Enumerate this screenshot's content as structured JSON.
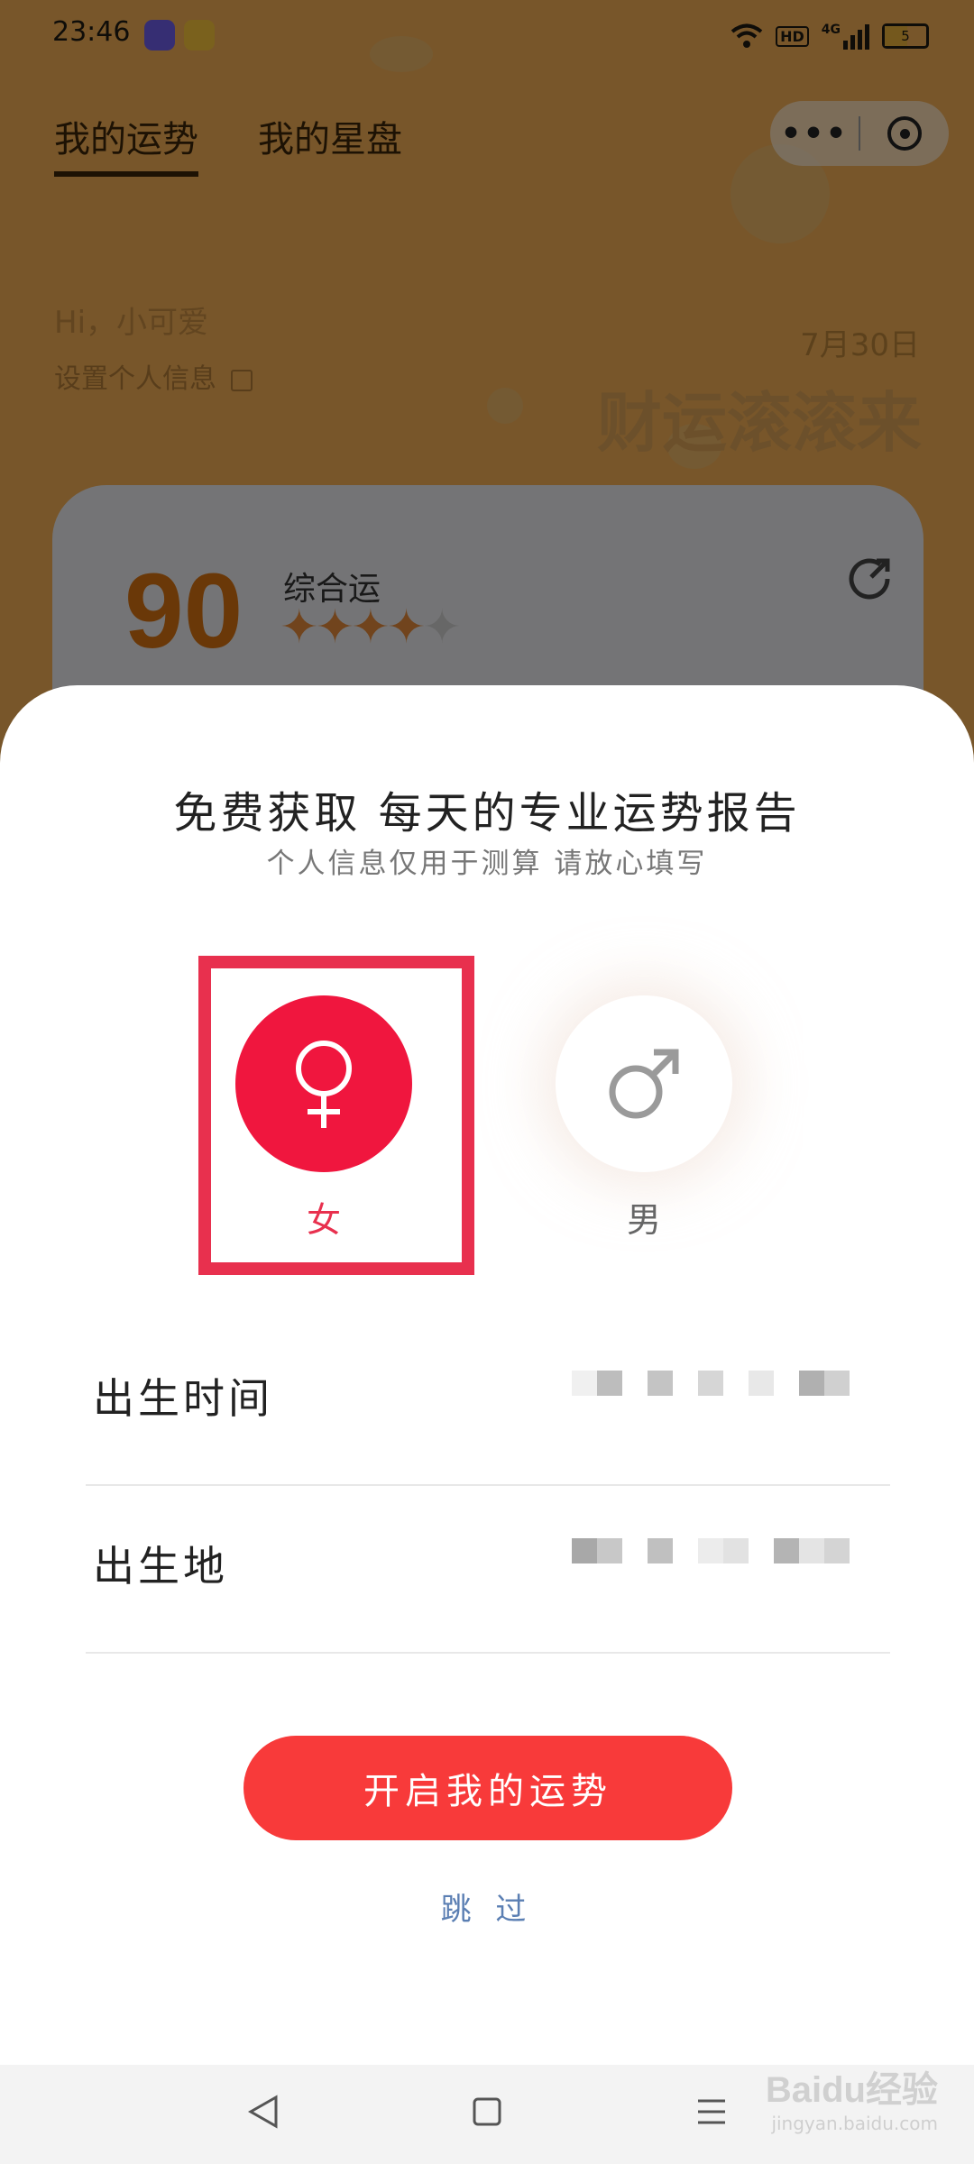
{
  "status_bar": {
    "time": "23:46",
    "left_icons": [
      "app-icon-purple",
      "weibo-icon"
    ],
    "right_icons": [
      "wifi-icon",
      "hd-icon",
      "4g-signal-icon",
      "battery-icon"
    ],
    "hd_label": "HD",
    "network_label": "4G",
    "battery_level": "5"
  },
  "background_page": {
    "tabs": [
      {
        "label": "我的运势",
        "active": true
      },
      {
        "label": "我的星盘",
        "active": false
      }
    ],
    "capsule": {
      "more_label": "•••"
    },
    "greeting": "Hi，小可爱",
    "set_info_link": "设置个人信息",
    "date": "7月30日",
    "fortune_headline": "财运滚滚来",
    "score_card": {
      "score": "90",
      "score_label": "综合运",
      "stars_filled": 4,
      "stars_total": 5
    }
  },
  "sheet": {
    "title": "免费获取 每天的专业运势报告",
    "subtitle": "个人信息仅用于测算 请放心填写",
    "gender_options": [
      {
        "label": "女",
        "symbol": "♀",
        "selected": true
      },
      {
        "label": "男",
        "symbol": "♂",
        "selected": false
      }
    ],
    "fields": [
      {
        "label": "出生时间",
        "value_obscured": true
      },
      {
        "label": "出生地",
        "value_obscured": true
      }
    ],
    "primary_button": "开启我的运势",
    "skip_link": "跳 过"
  },
  "nav_bar": {
    "buttons": [
      "back-icon",
      "home-icon",
      "menu-icon"
    ]
  },
  "watermark": {
    "main": "Baidu经验",
    "sub": "jingyan.baidu.com"
  },
  "colors": {
    "accent_red": "#f83a3a",
    "female_red": "#f0163e",
    "highlight_box": "#e8304e",
    "skip_blue": "#5b7fb3",
    "score_orange": "#d47010"
  }
}
